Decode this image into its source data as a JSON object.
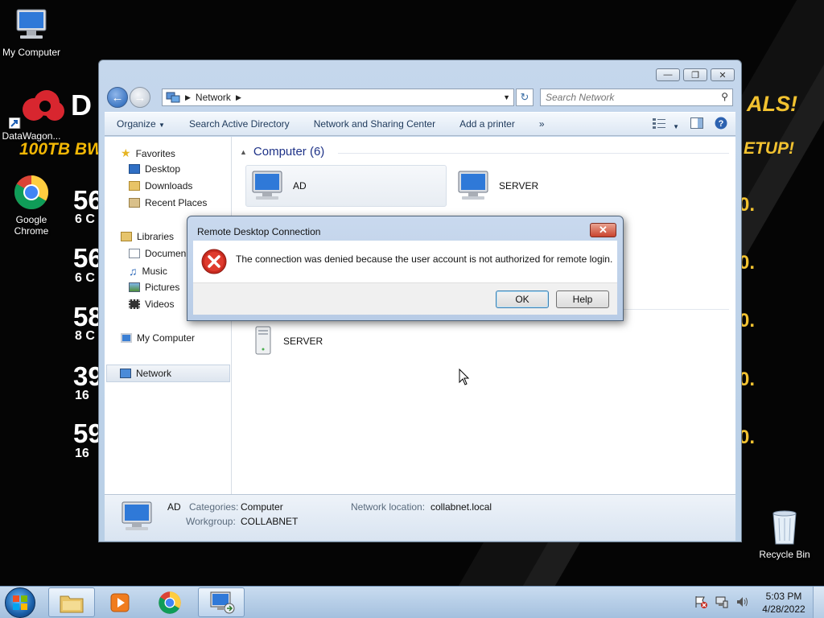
{
  "desktop": {
    "icons": [
      {
        "label": "My Computer",
        "icon": "computer-icon"
      },
      {
        "label": "DataWagon...",
        "icon": "shortcut-icon"
      },
      {
        "label": "Google\nChrome",
        "icon": "chrome-icon"
      },
      {
        "label": "Recycle Bin",
        "icon": "recycle-bin-icon"
      }
    ],
    "wallpaper": {
      "brand": "D",
      "tagline": "100TB BW",
      "deals": "ALS!",
      "setup": "ETUP!",
      "rows": [
        {
          "num": "56",
          "sub": "6 C"
        },
        {
          "num": "56",
          "sub": "6 C"
        },
        {
          "num": "58",
          "sub": "8 C"
        },
        {
          "num": "39",
          "sub": "16"
        },
        {
          "num": "59",
          "sub": "16"
        }
      ],
      "dot": "0."
    }
  },
  "explorer": {
    "address": {
      "location": "Network"
    },
    "search": {
      "placeholder": "Search Network"
    },
    "toolbar": {
      "organize": "Organize",
      "search_ad": "Search Active Directory",
      "network_center": "Network and Sharing Center",
      "add_printer": "Add a printer",
      "more": "»"
    },
    "navpane": {
      "favorites": "Favorites",
      "desktop": "Desktop",
      "downloads": "Downloads",
      "recent": "Recent Places",
      "libraries": "Libraries",
      "documents": "Documen",
      "music": "Music",
      "pictures": "Pictures",
      "videos": "Videos",
      "my_computer": "My Computer",
      "network": "Network"
    },
    "group": {
      "title": "Computer (6)"
    },
    "items": {
      "ad": "AD",
      "server1": "SERVER",
      "server2": "SERVER"
    },
    "details": {
      "name": "AD",
      "categories_label": "Categories:",
      "categories_value": "Computer",
      "workgroup_label": "Workgroup:",
      "workgroup_value": "COLLABNET",
      "location_label": "Network location:",
      "location_value": "collabnet.local"
    }
  },
  "dialog": {
    "title": "Remote Desktop Connection",
    "message": "The connection was denied because the user account is not authorized for remote login.",
    "ok": "OK",
    "help": "Help"
  },
  "taskbar": {
    "time": "5:03 PM",
    "date": "4/28/2022"
  }
}
